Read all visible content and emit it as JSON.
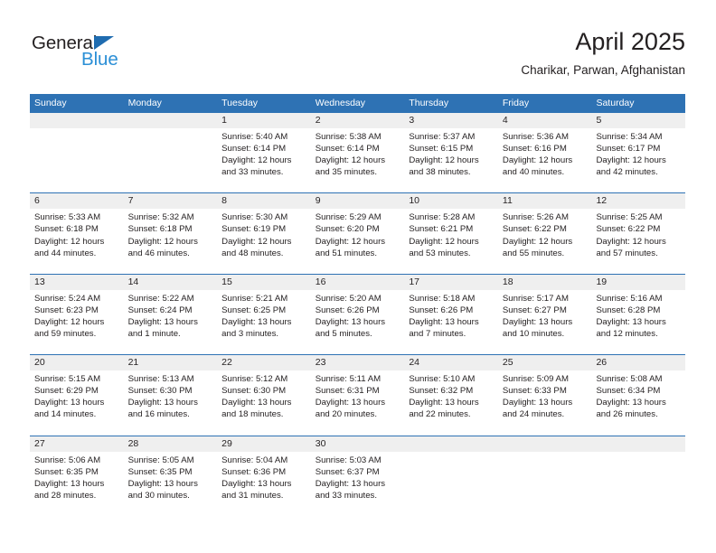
{
  "brand": {
    "name_dark": "General",
    "name_light": "Blue",
    "accent_dark": "#231f20",
    "accent_blue": "#1f6cb0",
    "accent_light_blue": "#2b8fd6"
  },
  "header": {
    "title": "April 2025",
    "subtitle": "Charikar, Parwan, Afghanistan"
  },
  "theme": {
    "header_bar": "#2e72b4",
    "date_strip": "#efefef",
    "text": "#231f20",
    "cell_bg": "#ffffff"
  },
  "weekday_headers": [
    "Sunday",
    "Monday",
    "Tuesday",
    "Wednesday",
    "Thursday",
    "Friday",
    "Saturday"
  ],
  "labels": {
    "sunrise": "Sunrise:",
    "sunset": "Sunset:",
    "daylight": "Daylight:"
  },
  "weeks": [
    [
      {
        "day": "",
        "empty": true
      },
      {
        "day": "",
        "empty": true
      },
      {
        "day": "1",
        "sunrise": "Sunrise: 5:40 AM",
        "sunset": "Sunset: 6:14 PM",
        "daylight_l1": "Daylight: 12 hours",
        "daylight_l2": "and 33 minutes."
      },
      {
        "day": "2",
        "sunrise": "Sunrise: 5:38 AM",
        "sunset": "Sunset: 6:14 PM",
        "daylight_l1": "Daylight: 12 hours",
        "daylight_l2": "and 35 minutes."
      },
      {
        "day": "3",
        "sunrise": "Sunrise: 5:37 AM",
        "sunset": "Sunset: 6:15 PM",
        "daylight_l1": "Daylight: 12 hours",
        "daylight_l2": "and 38 minutes."
      },
      {
        "day": "4",
        "sunrise": "Sunrise: 5:36 AM",
        "sunset": "Sunset: 6:16 PM",
        "daylight_l1": "Daylight: 12 hours",
        "daylight_l2": "and 40 minutes."
      },
      {
        "day": "5",
        "sunrise": "Sunrise: 5:34 AM",
        "sunset": "Sunset: 6:17 PM",
        "daylight_l1": "Daylight: 12 hours",
        "daylight_l2": "and 42 minutes."
      }
    ],
    [
      {
        "day": "6",
        "sunrise": "Sunrise: 5:33 AM",
        "sunset": "Sunset: 6:18 PM",
        "daylight_l1": "Daylight: 12 hours",
        "daylight_l2": "and 44 minutes."
      },
      {
        "day": "7",
        "sunrise": "Sunrise: 5:32 AM",
        "sunset": "Sunset: 6:18 PM",
        "daylight_l1": "Daylight: 12 hours",
        "daylight_l2": "and 46 minutes."
      },
      {
        "day": "8",
        "sunrise": "Sunrise: 5:30 AM",
        "sunset": "Sunset: 6:19 PM",
        "daylight_l1": "Daylight: 12 hours",
        "daylight_l2": "and 48 minutes."
      },
      {
        "day": "9",
        "sunrise": "Sunrise: 5:29 AM",
        "sunset": "Sunset: 6:20 PM",
        "daylight_l1": "Daylight: 12 hours",
        "daylight_l2": "and 51 minutes."
      },
      {
        "day": "10",
        "sunrise": "Sunrise: 5:28 AM",
        "sunset": "Sunset: 6:21 PM",
        "daylight_l1": "Daylight: 12 hours",
        "daylight_l2": "and 53 minutes."
      },
      {
        "day": "11",
        "sunrise": "Sunrise: 5:26 AM",
        "sunset": "Sunset: 6:22 PM",
        "daylight_l1": "Daylight: 12 hours",
        "daylight_l2": "and 55 minutes."
      },
      {
        "day": "12",
        "sunrise": "Sunrise: 5:25 AM",
        "sunset": "Sunset: 6:22 PM",
        "daylight_l1": "Daylight: 12 hours",
        "daylight_l2": "and 57 minutes."
      }
    ],
    [
      {
        "day": "13",
        "sunrise": "Sunrise: 5:24 AM",
        "sunset": "Sunset: 6:23 PM",
        "daylight_l1": "Daylight: 12 hours",
        "daylight_l2": "and 59 minutes."
      },
      {
        "day": "14",
        "sunrise": "Sunrise: 5:22 AM",
        "sunset": "Sunset: 6:24 PM",
        "daylight_l1": "Daylight: 13 hours",
        "daylight_l2": "and 1 minute."
      },
      {
        "day": "15",
        "sunrise": "Sunrise: 5:21 AM",
        "sunset": "Sunset: 6:25 PM",
        "daylight_l1": "Daylight: 13 hours",
        "daylight_l2": "and 3 minutes."
      },
      {
        "day": "16",
        "sunrise": "Sunrise: 5:20 AM",
        "sunset": "Sunset: 6:26 PM",
        "daylight_l1": "Daylight: 13 hours",
        "daylight_l2": "and 5 minutes."
      },
      {
        "day": "17",
        "sunrise": "Sunrise: 5:18 AM",
        "sunset": "Sunset: 6:26 PM",
        "daylight_l1": "Daylight: 13 hours",
        "daylight_l2": "and 7 minutes."
      },
      {
        "day": "18",
        "sunrise": "Sunrise: 5:17 AM",
        "sunset": "Sunset: 6:27 PM",
        "daylight_l1": "Daylight: 13 hours",
        "daylight_l2": "and 10 minutes."
      },
      {
        "day": "19",
        "sunrise": "Sunrise: 5:16 AM",
        "sunset": "Sunset: 6:28 PM",
        "daylight_l1": "Daylight: 13 hours",
        "daylight_l2": "and 12 minutes."
      }
    ],
    [
      {
        "day": "20",
        "sunrise": "Sunrise: 5:15 AM",
        "sunset": "Sunset: 6:29 PM",
        "daylight_l1": "Daylight: 13 hours",
        "daylight_l2": "and 14 minutes."
      },
      {
        "day": "21",
        "sunrise": "Sunrise: 5:13 AM",
        "sunset": "Sunset: 6:30 PM",
        "daylight_l1": "Daylight: 13 hours",
        "daylight_l2": "and 16 minutes."
      },
      {
        "day": "22",
        "sunrise": "Sunrise: 5:12 AM",
        "sunset": "Sunset: 6:30 PM",
        "daylight_l1": "Daylight: 13 hours",
        "daylight_l2": "and 18 minutes."
      },
      {
        "day": "23",
        "sunrise": "Sunrise: 5:11 AM",
        "sunset": "Sunset: 6:31 PM",
        "daylight_l1": "Daylight: 13 hours",
        "daylight_l2": "and 20 minutes."
      },
      {
        "day": "24",
        "sunrise": "Sunrise: 5:10 AM",
        "sunset": "Sunset: 6:32 PM",
        "daylight_l1": "Daylight: 13 hours",
        "daylight_l2": "and 22 minutes."
      },
      {
        "day": "25",
        "sunrise": "Sunrise: 5:09 AM",
        "sunset": "Sunset: 6:33 PM",
        "daylight_l1": "Daylight: 13 hours",
        "daylight_l2": "and 24 minutes."
      },
      {
        "day": "26",
        "sunrise": "Sunrise: 5:08 AM",
        "sunset": "Sunset: 6:34 PM",
        "daylight_l1": "Daylight: 13 hours",
        "daylight_l2": "and 26 minutes."
      }
    ],
    [
      {
        "day": "27",
        "sunrise": "Sunrise: 5:06 AM",
        "sunset": "Sunset: 6:35 PM",
        "daylight_l1": "Daylight: 13 hours",
        "daylight_l2": "and 28 minutes."
      },
      {
        "day": "28",
        "sunrise": "Sunrise: 5:05 AM",
        "sunset": "Sunset: 6:35 PM",
        "daylight_l1": "Daylight: 13 hours",
        "daylight_l2": "and 30 minutes."
      },
      {
        "day": "29",
        "sunrise": "Sunrise: 5:04 AM",
        "sunset": "Sunset: 6:36 PM",
        "daylight_l1": "Daylight: 13 hours",
        "daylight_l2": "and 31 minutes."
      },
      {
        "day": "30",
        "sunrise": "Sunrise: 5:03 AM",
        "sunset": "Sunset: 6:37 PM",
        "daylight_l1": "Daylight: 13 hours",
        "daylight_l2": "and 33 minutes."
      },
      {
        "day": "",
        "empty": true
      },
      {
        "day": "",
        "empty": true
      },
      {
        "day": "",
        "empty": true
      }
    ]
  ]
}
